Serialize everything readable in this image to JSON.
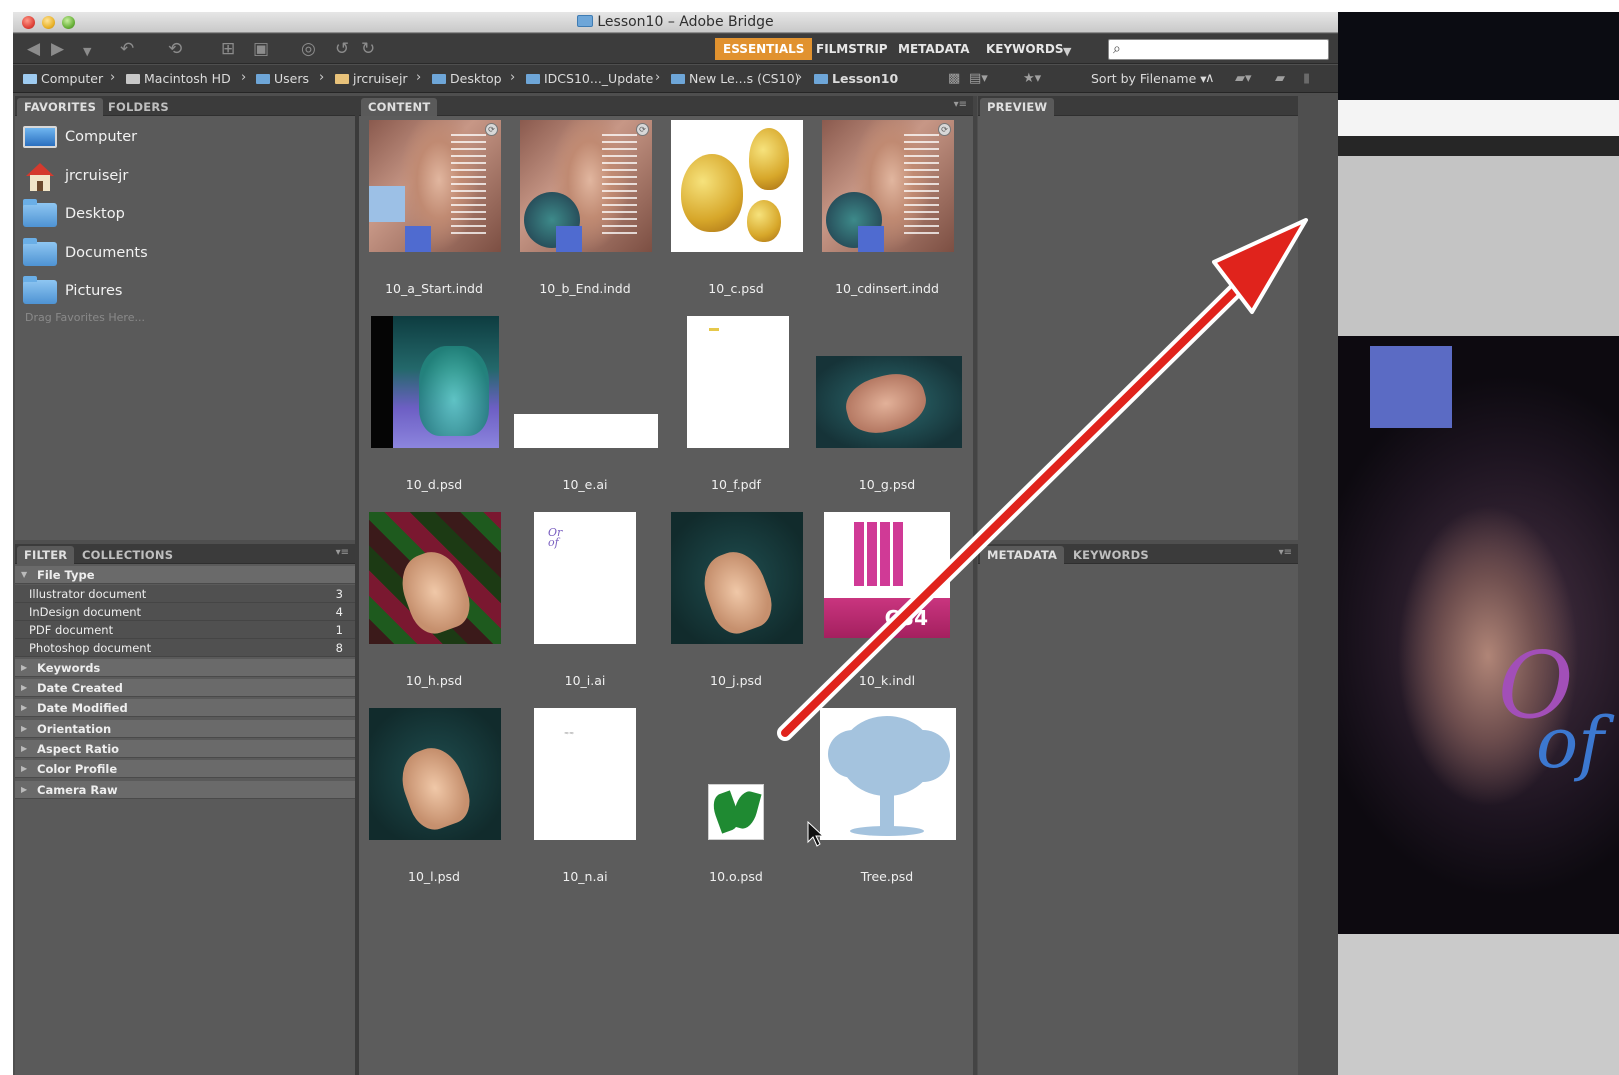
{
  "window": {
    "title": "Lesson10 – Adobe Bridge"
  },
  "toolbar": {
    "workspaces": [
      "ESSENTIALS",
      "FILMSTRIP",
      "METADATA",
      "KEYWORDS"
    ],
    "active_workspace": "ESSENTIALS",
    "search_placeholder": ""
  },
  "pathbar": {
    "crumbs": [
      "Computer",
      "Macintosh HD",
      "Users",
      "jrcruisejr",
      "Desktop",
      "IDCS10..._Update",
      "New Le...s (CS10)",
      "Lesson10"
    ],
    "sort_label": "Sort by Filename"
  },
  "favorites_panel": {
    "tabs": [
      "FAVORITES",
      "FOLDERS"
    ],
    "items": [
      {
        "label": "Computer",
        "icon": "computer-icon"
      },
      {
        "label": "jrcruisejr",
        "icon": "home-icon"
      },
      {
        "label": "Desktop",
        "icon": "folder-icon"
      },
      {
        "label": "Documents",
        "icon": "folder-icon"
      },
      {
        "label": "Pictures",
        "icon": "folder-icon"
      }
    ],
    "drag_hint": "Drag Favorites Here..."
  },
  "filter_panel": {
    "tabs": [
      "FILTER",
      "COLLECTIONS"
    ],
    "file_type_header": "File Type",
    "file_types": [
      {
        "name": "Illustrator document",
        "count": "3"
      },
      {
        "name": "InDesign document",
        "count": "4"
      },
      {
        "name": "PDF document",
        "count": "1"
      },
      {
        "name": "Photoshop document",
        "count": "8"
      }
    ],
    "collapsed_sections": [
      "Keywords",
      "Date Created",
      "Date Modified",
      "Orientation",
      "Aspect Ratio",
      "Color Profile",
      "Camera Raw"
    ]
  },
  "content_panel": {
    "tab": "CONTENT",
    "files": [
      "10_a_Start.indd",
      "10_b_End.indd",
      "10_c.psd",
      "10_cdinsert.indd",
      "10_d.psd",
      "10_e.ai",
      "10_f.pdf",
      "10_g.psd",
      "10_h.psd",
      "10_i.ai",
      "10_j.psd",
      "10_k.indl",
      "10_l.psd",
      "10_n.ai",
      "10.o.psd",
      "Tree.psd"
    ],
    "k_thumb_text": "CS4"
  },
  "preview_panel": {
    "tab": "PREVIEW"
  },
  "metadata_panel": {
    "tabs": [
      "METADATA",
      "KEYWORDS"
    ]
  },
  "colors": {
    "accent": "#e1922f",
    "arrow": "#e0231c"
  }
}
